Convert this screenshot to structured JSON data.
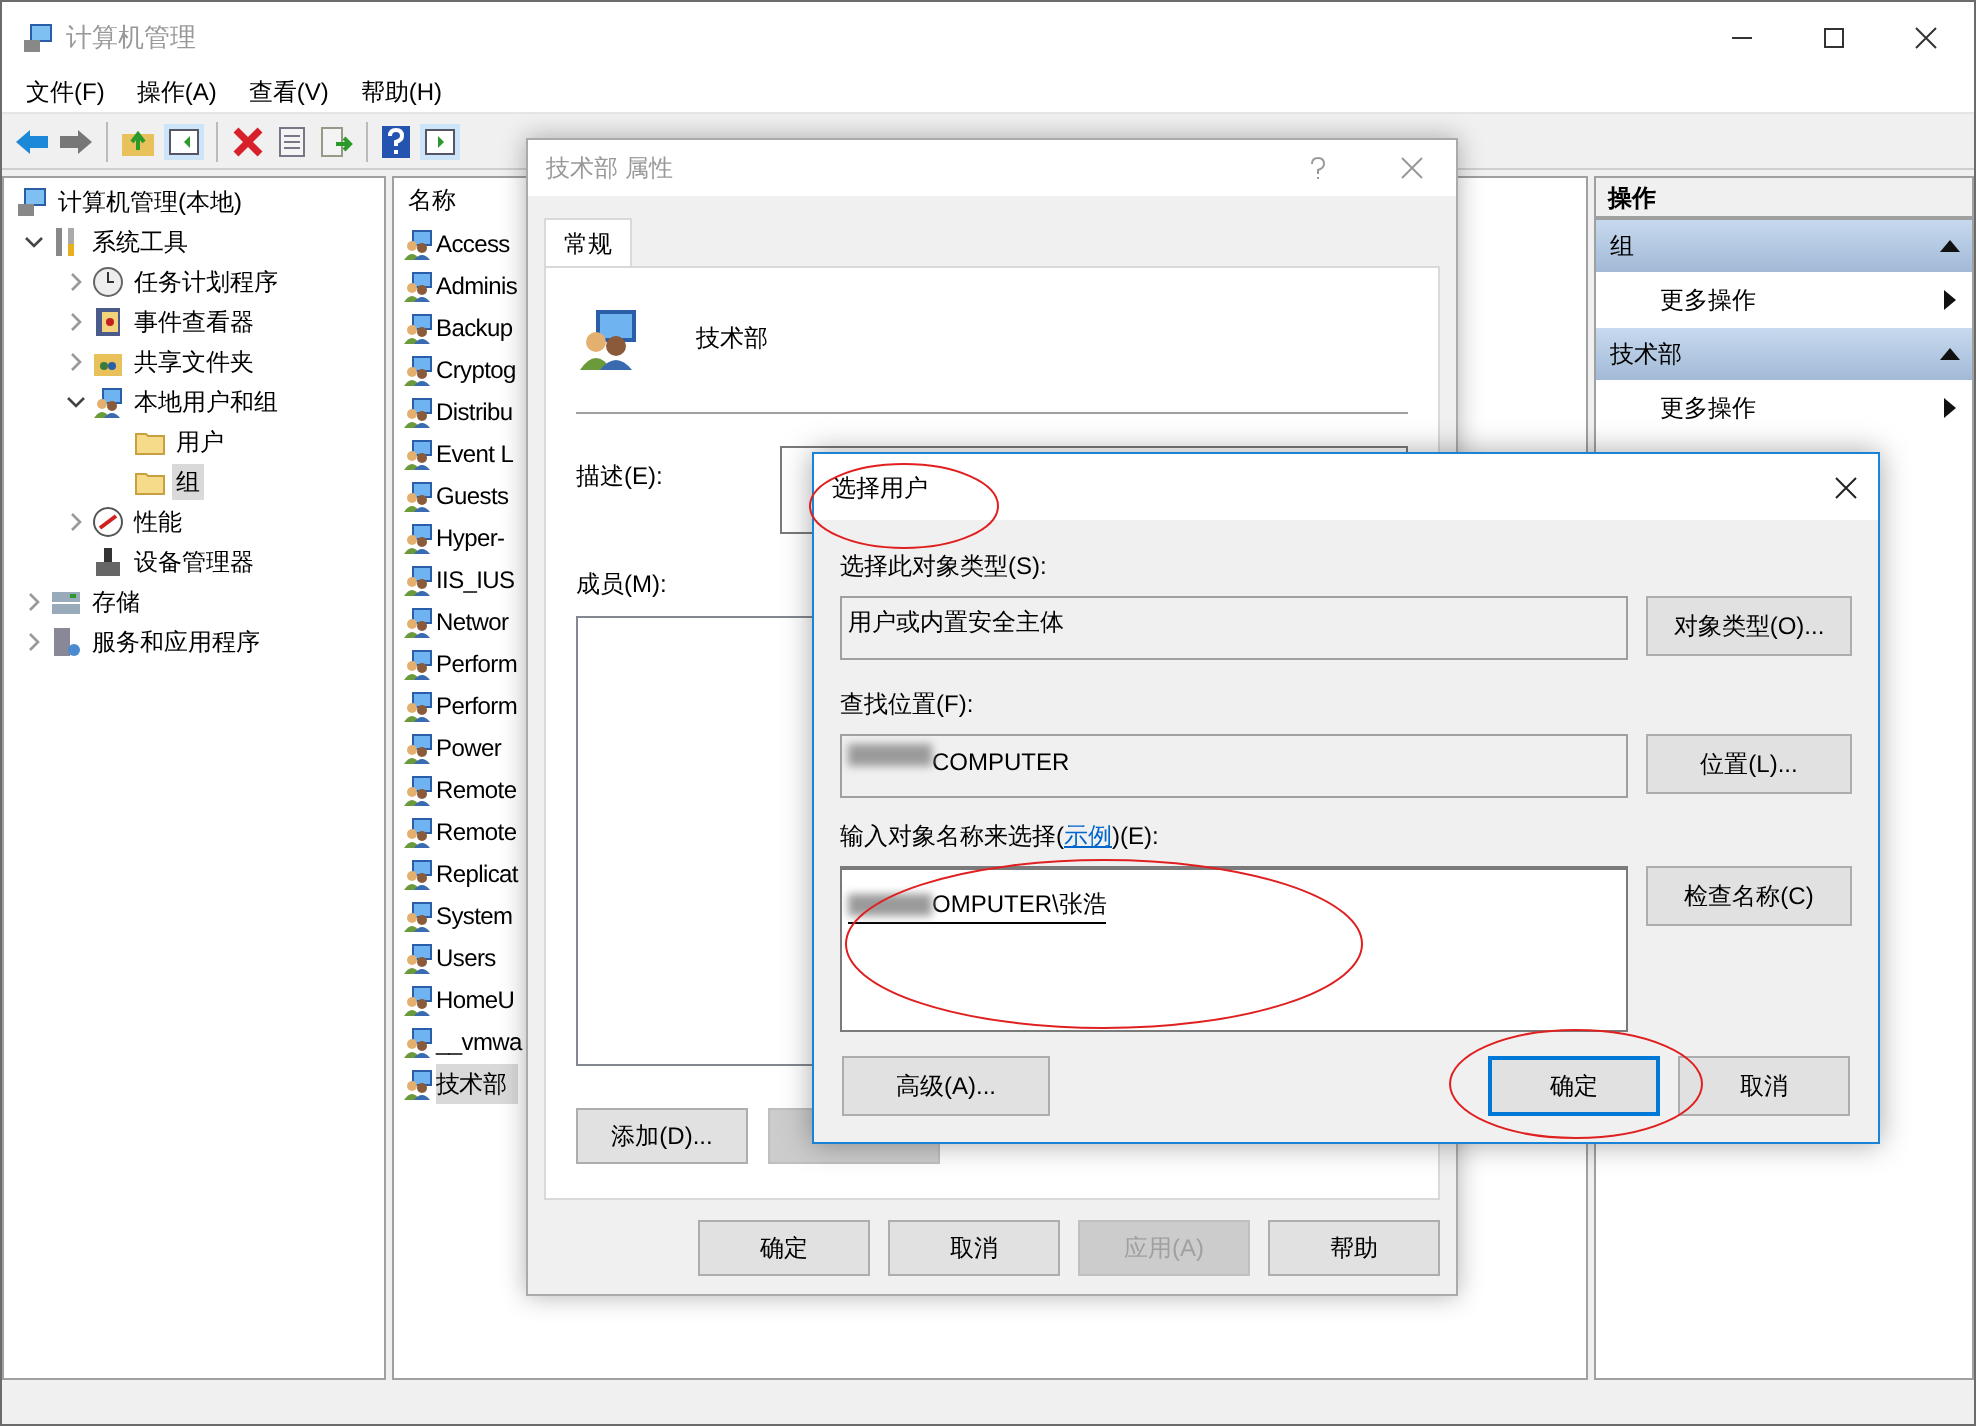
{
  "window": {
    "title": "计算机管理"
  },
  "menu": [
    "文件(F)",
    "操作(A)",
    "查看(V)",
    "帮助(H)"
  ],
  "tree": [
    {
      "label": "计算机管理(本地)",
      "selected": false,
      "children": [
        {
          "label": "系统工具",
          "selected": false,
          "expanded": true,
          "children": [
            {
              "label": "任务计划程序",
              "selected": false,
              "expanded": false
            },
            {
              "label": "事件查看器",
              "selected": false,
              "expanded": false
            },
            {
              "label": "共享文件夹",
              "selected": false,
              "expanded": false
            },
            {
              "label": "本地用户和组",
              "selected": false,
              "expanded": true,
              "children": [
                {
                  "label": "用户",
                  "selected": false
                },
                {
                  "label": "组",
                  "selected": true
                }
              ]
            },
            {
              "label": "性能",
              "selected": false,
              "expanded": false
            },
            {
              "label": "设备管理器",
              "selected": false
            }
          ]
        },
        {
          "label": "存储",
          "selected": false,
          "expanded": false
        },
        {
          "label": "服务和应用程序",
          "selected": false,
          "expanded": false
        }
      ]
    }
  ],
  "list": {
    "column": "名称",
    "rows": [
      {
        "name": "Access",
        "selected": false
      },
      {
        "name": "Adminis",
        "selected": false
      },
      {
        "name": "Backup",
        "selected": false
      },
      {
        "name": "Cryptog",
        "selected": false
      },
      {
        "name": "Distribu",
        "selected": false
      },
      {
        "name": "Event L",
        "selected": false
      },
      {
        "name": "Guests",
        "selected": false
      },
      {
        "name": "Hyper-",
        "selected": false
      },
      {
        "name": "IIS_IUS",
        "selected": false
      },
      {
        "name": "Networ",
        "selected": false
      },
      {
        "name": "Perform",
        "selected": false
      },
      {
        "name": "Perform",
        "selected": false
      },
      {
        "name": "Power",
        "selected": false
      },
      {
        "name": "Remote",
        "selected": false
      },
      {
        "name": "Remote",
        "selected": false
      },
      {
        "name": "Replicat",
        "selected": false
      },
      {
        "name": "System",
        "selected": false
      },
      {
        "name": "Users",
        "selected": false
      },
      {
        "name": "HomeU",
        "selected": false
      },
      {
        "name": "__vmwa",
        "selected": false
      },
      {
        "name": "技术部",
        "selected": true
      }
    ]
  },
  "actions": {
    "title": "操作",
    "sections": [
      {
        "title": "组",
        "items": [
          "更多操作"
        ]
      },
      {
        "title": "技术部",
        "items": [
          "更多操作"
        ]
      }
    ]
  },
  "properties_dialog": {
    "title": "技术部 属性",
    "tabs": [
      {
        "label": "常规",
        "selected": true
      }
    ],
    "group_name": "技术部",
    "description_label": "描述(E):",
    "members_label": "成员(M):",
    "add_button": "添加(D)...",
    "remove_button": {
      "disabled": true
    },
    "buttons": [
      {
        "label": "确定",
        "disabled": false
      },
      {
        "label": "取消",
        "disabled": false
      },
      {
        "label": "应用(A)",
        "disabled": true
      },
      {
        "label": "帮助",
        "disabled": false
      }
    ]
  },
  "select_dialog": {
    "title": "选择用户",
    "object_type_label": "选择此对象类型(S):",
    "object_type_value": "用户或内置安全主体",
    "object_type_button": "对象类型(O)...",
    "location_label": "查找位置(F):",
    "location_value": "COMPUTER",
    "location_button": "位置(L)...",
    "names_label_before": "输入对象名称来选择(",
    "names_link": "示例",
    "names_label_after": ")(E):",
    "names_value": "OMPUTER\\张浩",
    "check_button": "检查名称(C)",
    "advanced_button": "高级(A)...",
    "buttons": [
      {
        "label": "确定",
        "default": true
      },
      {
        "label": "取消",
        "default": false
      }
    ]
  }
}
